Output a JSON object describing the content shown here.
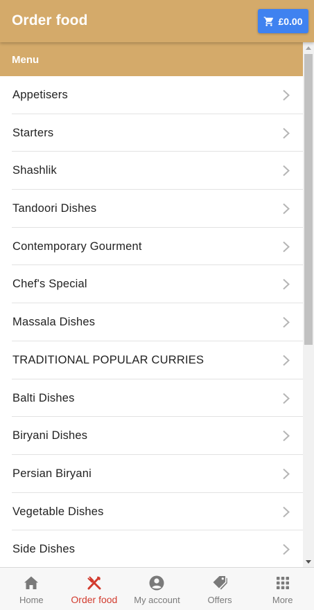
{
  "header": {
    "title": "Order food",
    "cart_total": "£0.00",
    "cart_icon": "shopping-cart-icon"
  },
  "section": {
    "title": "Menu"
  },
  "menu_items": [
    {
      "label": "Appetisers"
    },
    {
      "label": "Starters"
    },
    {
      "label": "Shashlik"
    },
    {
      "label": "Tandoori Dishes"
    },
    {
      "label": "Contemporary Gourment"
    },
    {
      "label": "Chef's Special"
    },
    {
      "label": "Massala Dishes"
    },
    {
      "label": "TRADITIONAL POPULAR CURRIES"
    },
    {
      "label": "Balti Dishes"
    },
    {
      "label": "Biryani Dishes"
    },
    {
      "label": "Persian Biryani"
    },
    {
      "label": "Vegetable Dishes"
    },
    {
      "label": "Side Dishes"
    }
  ],
  "tabs": [
    {
      "label": "Home",
      "icon": "home-icon",
      "active": false
    },
    {
      "label": "Order food",
      "icon": "fork-knife-icon",
      "active": true
    },
    {
      "label": "My account",
      "icon": "account-circle-icon",
      "active": false
    },
    {
      "label": "Offers",
      "icon": "tags-icon",
      "active": false
    },
    {
      "label": "More",
      "icon": "grid-icon",
      "active": false
    }
  ],
  "colors": {
    "brand": "#d4aa6a",
    "cart_button": "#3f82f0",
    "active_tab": "#d23b2e",
    "inactive_tab": "#7a7a7a"
  }
}
